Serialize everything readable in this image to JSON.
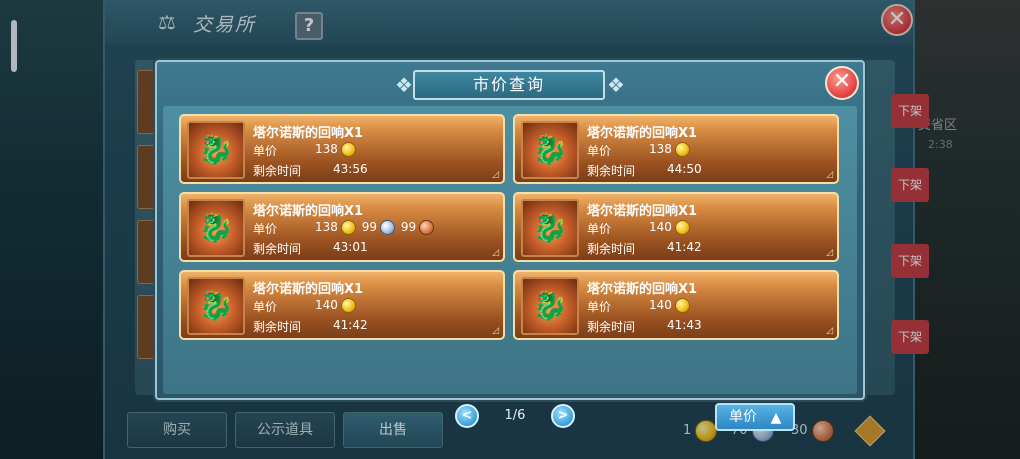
{
  "exchange": {
    "title": "交易所",
    "help": "?",
    "close": "✕",
    "unlist_label": "下架",
    "tabs": [
      "购买",
      "公示道具",
      "出售"
    ],
    "currency": {
      "gold": "1",
      "silver": "70",
      "copper": "30"
    }
  },
  "background": {
    "right_text": "交省区",
    "right_text2": "2:38"
  },
  "modal": {
    "title": "市价查询",
    "close": "✕",
    "price_label": "单价",
    "time_label": "剩余时间",
    "items": [
      {
        "name": "塔尔诺斯的回响X1",
        "price": "138",
        "extra": [],
        "time": "43:56"
      },
      {
        "name": "塔尔诺斯的回响X1",
        "price": "138",
        "extra": [],
        "time": "44:50"
      },
      {
        "name": "塔尔诺斯的回响X1",
        "price": "138",
        "extra": [
          "99",
          "99"
        ],
        "time": "43:01"
      },
      {
        "name": "塔尔诺斯的回响X1",
        "price": "140",
        "extra": [],
        "time": "41:42"
      },
      {
        "name": "塔尔诺斯的回响X1",
        "price": "140",
        "extra": [],
        "time": "41:42"
      },
      {
        "name": "塔尔诺斯的回响X1",
        "price": "140",
        "extra": [],
        "time": "41:43"
      }
    ],
    "pager": {
      "text": "1/6",
      "prev": "<",
      "next": ">"
    },
    "sort_label": "单价"
  },
  "colors": {
    "accent": "#3f86a0",
    "card": "#d98d44",
    "close": "#e03c41"
  }
}
